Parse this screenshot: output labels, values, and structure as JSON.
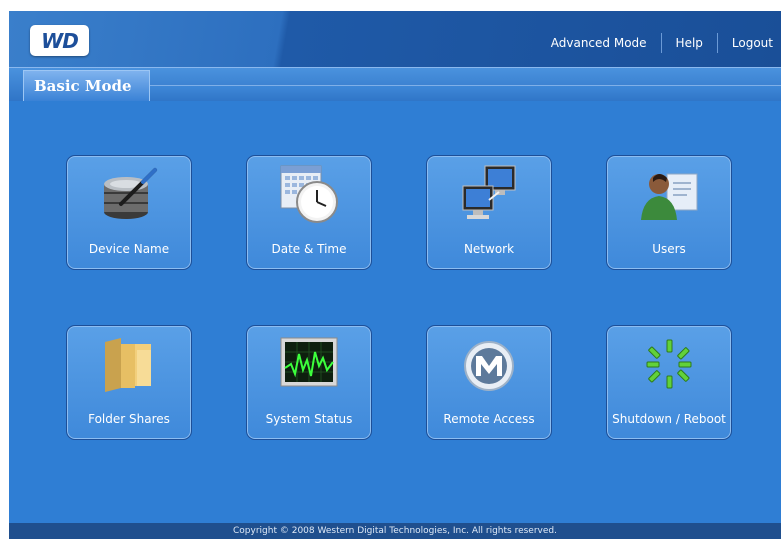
{
  "header": {
    "logo_text": "WD",
    "nav": {
      "advanced_mode": "Advanced Mode",
      "help": "Help",
      "logout": "Logout"
    }
  },
  "tabs": {
    "active_label": "Basic Mode"
  },
  "tiles": [
    {
      "label": "Device Name",
      "icon": "database-pen-icon"
    },
    {
      "label": "Date & Time",
      "icon": "calendar-clock-icon"
    },
    {
      "label": "Network",
      "icon": "network-computers-icon"
    },
    {
      "label": "Users",
      "icon": "users-icon"
    },
    {
      "label": "Folder Shares",
      "icon": "folder-icon"
    },
    {
      "label": "System Status",
      "icon": "system-monitor-icon"
    },
    {
      "label": "Remote Access",
      "icon": "remote-access-icon"
    },
    {
      "label": "Shutdown / Reboot",
      "icon": "shutdown-spinner-icon"
    }
  ],
  "footer": {
    "copyright": "Copyright © 2008 Western Digital Technologies, Inc. All rights reserved."
  },
  "colors": {
    "background": "#2f7ed4",
    "header": "#1a4f98",
    "tile": "#4a94e0",
    "footer": "#1f4f8e",
    "text": "#ffffff"
  }
}
